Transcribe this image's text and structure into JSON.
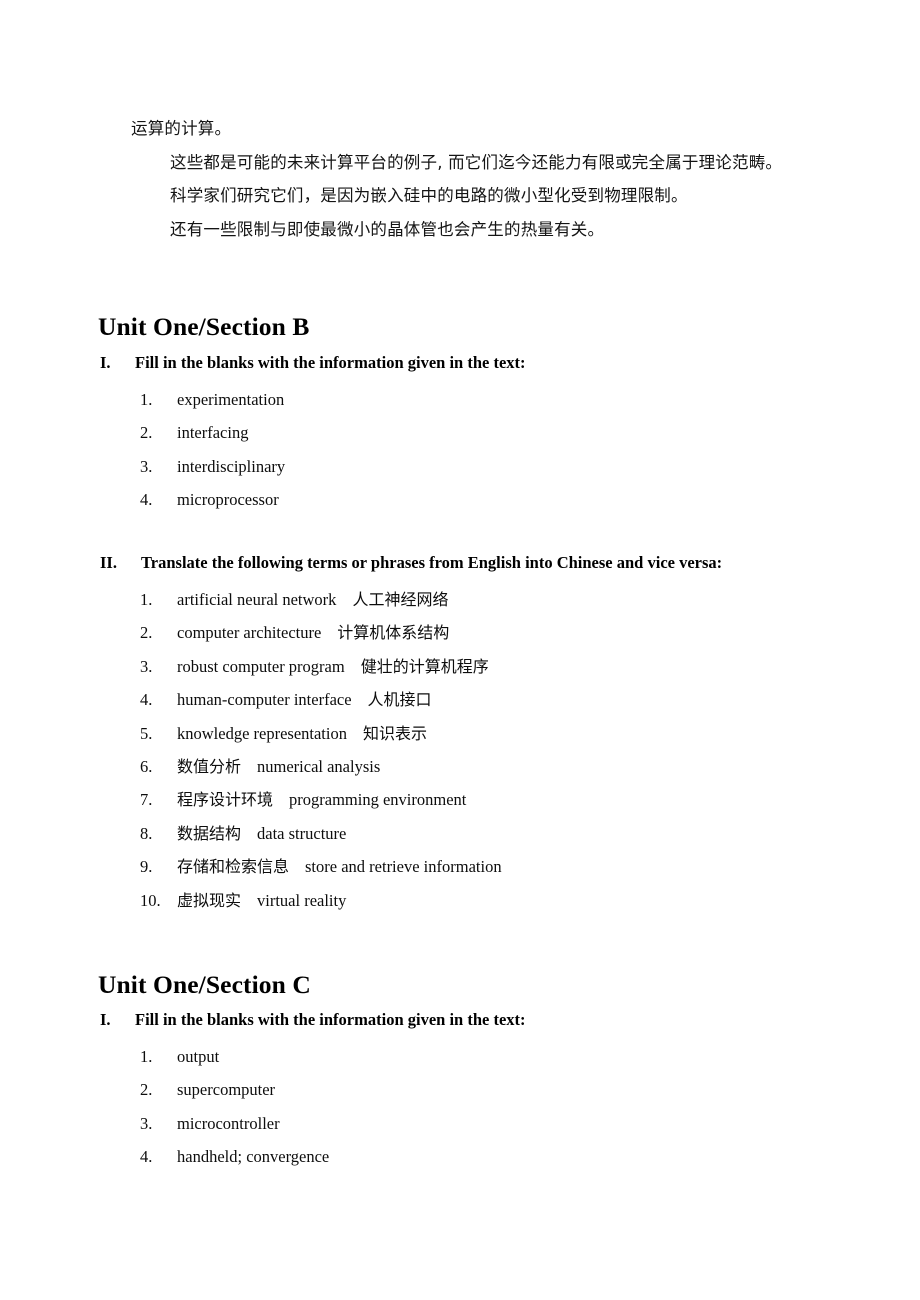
{
  "document": {
    "intro_paragraph": {
      "lines": [
        "运算的计算。",
        "这些都是可能的未来计算平台的例子, 而它们迄今还能力有限或完全属于理论范畴。",
        "科学家们研究它们，是因为嵌入硅中的电路的微小型化受到物理限制。",
        "还有一些限制与即使最微小的晶体管也会产生的热量有关。"
      ]
    },
    "sections": [
      {
        "unit_heading": "Unit One/Section B",
        "parts": [
          {
            "numeral": "I.",
            "title": "Fill in the blanks with the information given in the text:",
            "items": [
              {
                "num": "1.",
                "en": "experimentation",
                "zh": ""
              },
              {
                "num": "2.",
                "en": "interfacing",
                "zh": ""
              },
              {
                "num": "3.",
                "en": "interdisciplinary",
                "zh": ""
              },
              {
                "num": "4.",
                "en": "microprocessor",
                "zh": ""
              }
            ]
          },
          {
            "numeral": "II.",
            "title": "Translate the following terms or phrases from English into Chinese and vice versa:",
            "items": [
              {
                "num": "1.",
                "en": "artificial neural network",
                "zh": "人工神经网络"
              },
              {
                "num": "2.",
                "en": "computer architecture",
                "zh": "计算机体系结构"
              },
              {
                "num": "3.",
                "en": "robust computer program",
                "zh": "健壮的计算机程序"
              },
              {
                "num": "4.",
                "en": "human-computer interface",
                "zh": "人机接口"
              },
              {
                "num": "5.",
                "en": "knowledge representation",
                "zh": "知识表示"
              },
              {
                "num": "6.",
                "zh": "数值分析",
                "en": "numerical analysis",
                "zh_first": true
              },
              {
                "num": "7.",
                "zh": "程序设计环境",
                "en": "programming environment",
                "zh_first": true
              },
              {
                "num": "8.",
                "zh": "数据结构",
                "en": "data structure",
                "zh_first": true
              },
              {
                "num": "9.",
                "zh": "存储和检索信息",
                "en": "store and retrieve information",
                "zh_first": true
              },
              {
                "num": "10.",
                "zh": "虚拟现实",
                "en": "virtual reality",
                "zh_first": true
              }
            ]
          }
        ]
      },
      {
        "unit_heading": "Unit One/Section C",
        "parts": [
          {
            "numeral": "I.",
            "title": "Fill in the blanks with the information given in the text:",
            "items": [
              {
                "num": "1.",
                "en": "output",
                "zh": ""
              },
              {
                "num": "2.",
                "en": "supercomputer",
                "zh": ""
              },
              {
                "num": "3.",
                "en": "microcontroller",
                "zh": ""
              },
              {
                "num": "4.",
                "en": "handheld; convergence",
                "zh": ""
              }
            ]
          }
        ]
      }
    ]
  }
}
